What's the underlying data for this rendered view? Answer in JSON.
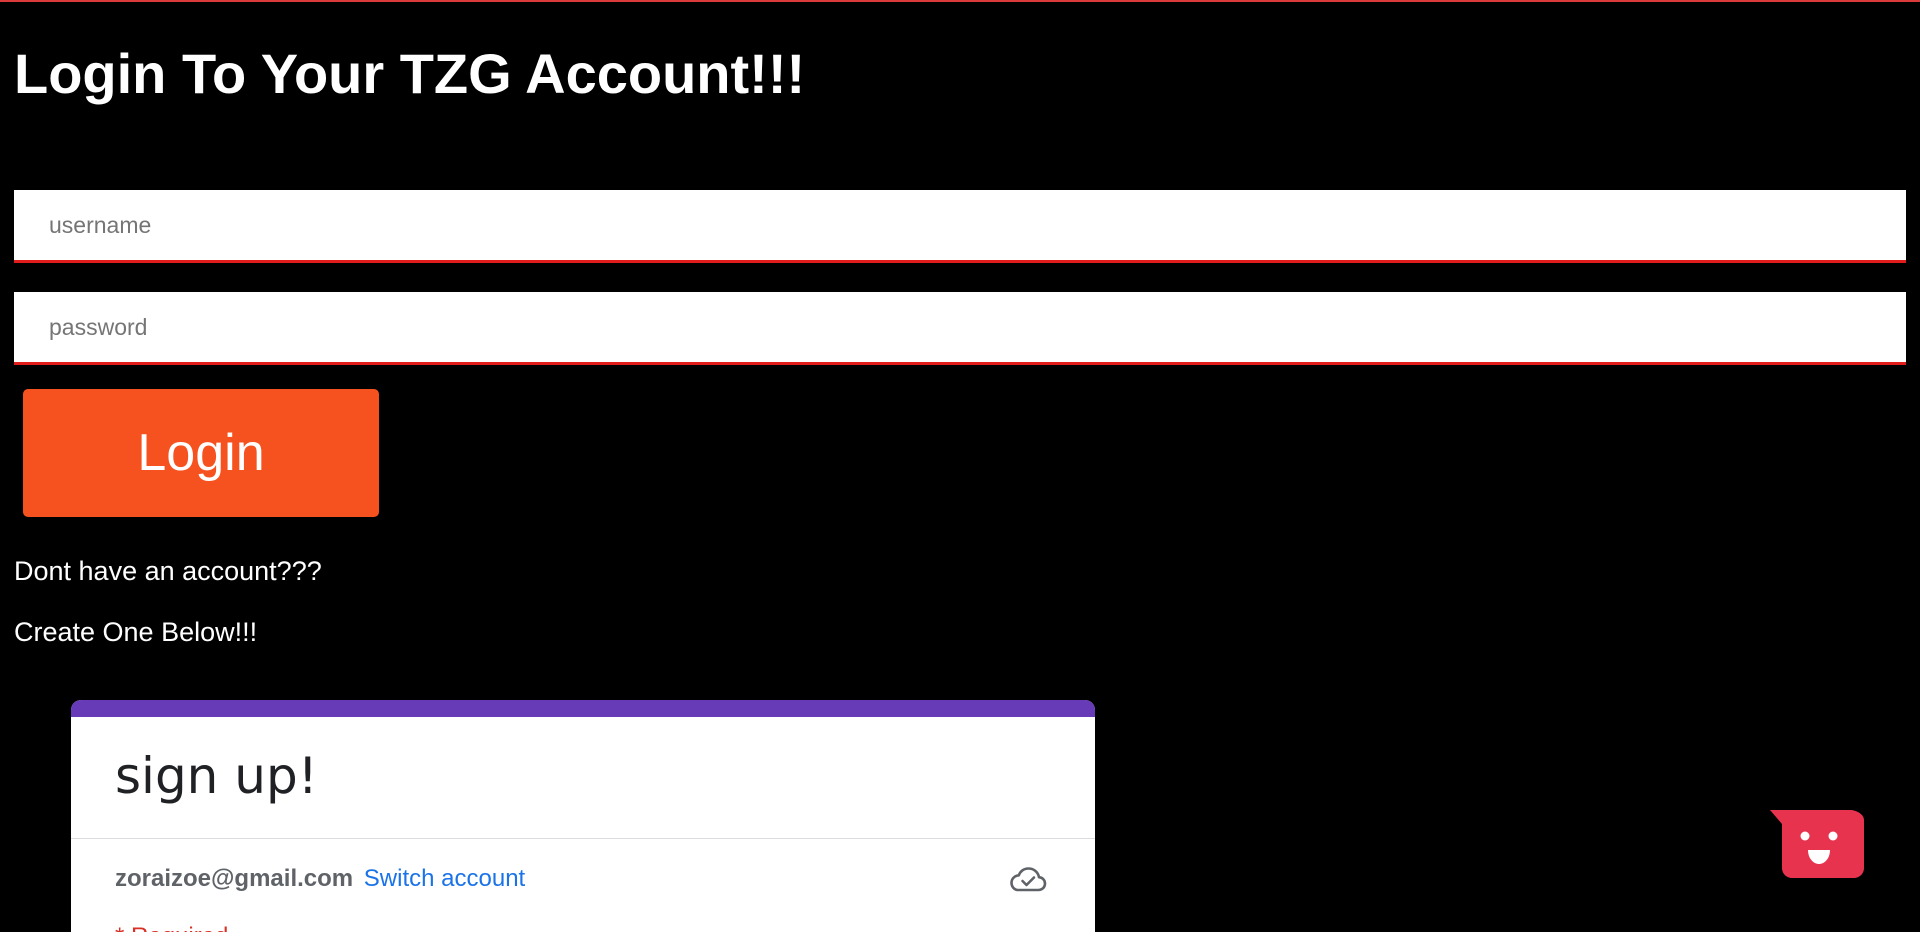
{
  "page": {
    "title": "Login To Your TZG Account!!!"
  },
  "login_form": {
    "username_placeholder": "username",
    "password_placeholder": "password",
    "login_label": "Login"
  },
  "prompts": {
    "no_account": "Dont have an account???",
    "create_one": "Create One Below!!!"
  },
  "signup_form": {
    "title": "sign up!",
    "account_email": "zoraizoe@gmail.com",
    "switch_account_label": "Switch account",
    "required_note": "* Required",
    "cloud_icon": "cloud-check-icon"
  },
  "chat_widget": {
    "icon": "smiley-chat-icon"
  },
  "colors": {
    "background": "#000000",
    "top_border": "#d93a3a",
    "input_underline": "#e21b1b",
    "login_button": "#f55220",
    "form_accent": "#673ab7",
    "link": "#1a73e8",
    "required": "#d93025",
    "chat_widget": "#e8334f"
  }
}
